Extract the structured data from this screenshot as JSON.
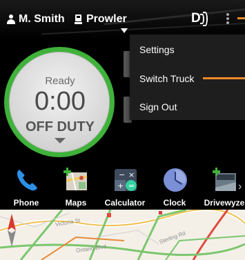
{
  "header": {
    "user_name": "M. Smith",
    "truck_name": "Prowler",
    "icons": [
      "user-icon",
      "truck-icon",
      "drivewyze-logo-icon",
      "overflow-menu-icon"
    ]
  },
  "status": {
    "ready_label": "Ready",
    "timer": "0:00",
    "duty_status": "OFF DUTY",
    "ring_color": "#3fb23a"
  },
  "menu": {
    "items": [
      "Settings",
      "Switch Truck",
      "Sign Out"
    ],
    "accent_color": "#f28c28"
  },
  "dock": {
    "apps": [
      {
        "label": "Phone",
        "icon": "phone-icon"
      },
      {
        "label": "Maps",
        "icon": "maps-icon"
      },
      {
        "label": "Calculator",
        "icon": "calculator-icon"
      },
      {
        "label": "Clock",
        "icon": "clock-icon"
      },
      {
        "label": "Drivewyze",
        "icon": "drivewyze-app-icon"
      }
    ]
  },
  "map": {
    "street_labels": [
      "Victoria St",
      "Sterling Rd",
      "Ontario Blvd"
    ]
  }
}
